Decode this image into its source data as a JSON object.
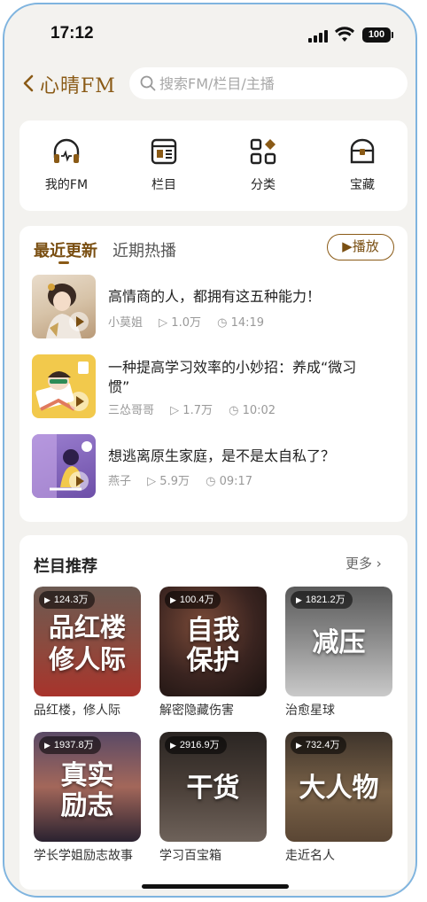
{
  "status_bar": {
    "time": "17:12",
    "battery": "100"
  },
  "header": {
    "logo": "心晴FM",
    "search_placeholder": "搜索FM/栏目/主播"
  },
  "quick_nav": [
    {
      "label": "我的FM",
      "icon": "headphones-icon"
    },
    {
      "label": "栏目",
      "icon": "column-list-icon"
    },
    {
      "label": "分类",
      "icon": "category-grid-icon"
    },
    {
      "label": "宝藏",
      "icon": "treasure-chest-icon"
    }
  ],
  "recent": {
    "tab_active": "最近更新",
    "tab_inactive": "近期热播",
    "play_label": "▶播放",
    "episodes": [
      {
        "title": "高情商的人，都拥有这五种能力！",
        "author": "小莫姐",
        "plays": "1.0万",
        "duration": "14:19"
      },
      {
        "title": "一种提高学习效率的小妙招：养成“微习惯”",
        "author": "三怂哥哥",
        "plays": "1.7万",
        "duration": "10:02"
      },
      {
        "title": "想逃离原生家庭，是不是太自私了？",
        "author": "燕子",
        "plays": "5.9万",
        "duration": "09:17"
      }
    ]
  },
  "columns": {
    "title": "栏目推荐",
    "more": "更多 ›",
    "items": [
      {
        "count": "124.3万",
        "art_line1": "品红楼",
        "art_line2": "修人际",
        "label": "品红楼，修人际"
      },
      {
        "count": "100.4万",
        "art_line1": "自我",
        "art_line2": "保护",
        "label": "解密隐藏伤害"
      },
      {
        "count": "1821.2万",
        "art_line1": "减压",
        "art_line2": "",
        "label": "治愈星球"
      },
      {
        "count": "1937.8万",
        "art_line1": "真实",
        "art_line2": "励志",
        "label": "学长学姐励志故事"
      },
      {
        "count": "2916.9万",
        "art_line1": "干货",
        "art_line2": "",
        "label": "学习百宝箱"
      },
      {
        "count": "732.4万",
        "art_line1": "大人物",
        "art_line2": "",
        "label": "走近名人"
      }
    ]
  },
  "colors": {
    "accent": "#8a5a16",
    "background": "#f3f2ef"
  }
}
